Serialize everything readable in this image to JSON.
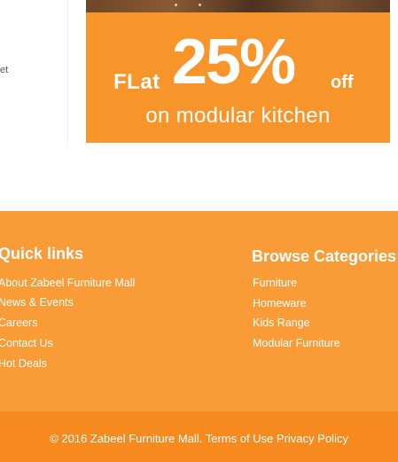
{
  "top": {
    "stray_text": "et"
  },
  "banner": {
    "flat": "FLat",
    "percent": "25%",
    "off": "off",
    "subtitle": "on modular kitchen"
  },
  "footer": {
    "quick_links": {
      "title": "Quick links",
      "items": [
        "About Zabeel Furniture Mall",
        "News & Events",
        "Careers",
        "Contact Us",
        "Hot Deals"
      ]
    },
    "browse_categories": {
      "title": "Browse Categories",
      "items": [
        "Furniture",
        "Homeware",
        "Kids Range",
        "Modular Furniture"
      ]
    }
  },
  "copyright": {
    "text": "© 2016 Zabeel Furniture Mall.",
    "terms": "Terms of Use",
    "privacy": "Privacy Policy"
  },
  "colors": {
    "footer_bg": "#f99b37",
    "copyright_bg": "#f78a1f",
    "banner_bg": "#f7952b"
  }
}
